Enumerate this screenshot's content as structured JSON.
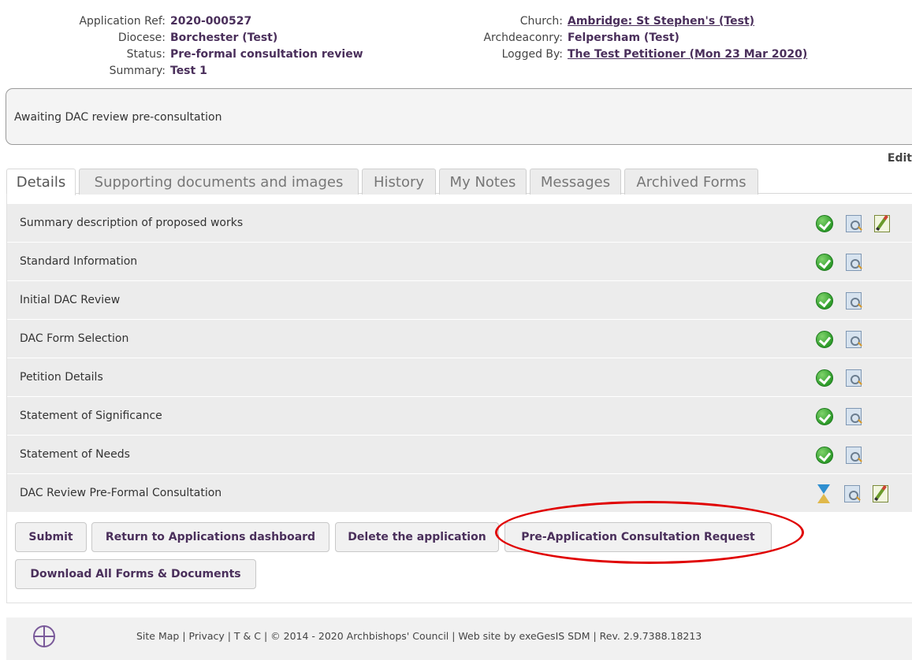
{
  "header": {
    "left": [
      {
        "label": "Application Ref:",
        "value": "2020-000527",
        "link": false
      },
      {
        "label": "Diocese:",
        "value": "Borchester (Test)",
        "link": false
      },
      {
        "label": "Status:",
        "value": "Pre-formal consultation review",
        "link": false
      },
      {
        "label": "Summary:",
        "value": "Test 1",
        "link": false
      }
    ],
    "right": [
      {
        "label": "Church:",
        "value": "Ambridge: St Stephen's (Test)",
        "link": true
      },
      {
        "label": "Archdeaconry:",
        "value": "Felpersham (Test)",
        "link": false
      },
      {
        "label": "Logged By:",
        "value": "The Test Petitioner (Mon 23 Mar 2020)",
        "link": true
      }
    ]
  },
  "status_message": "Awaiting DAC review pre-consultation",
  "edit_label": "Edit",
  "tabs": [
    {
      "label": "Details",
      "active": true
    },
    {
      "label": "Supporting documents and images",
      "active": false
    },
    {
      "label": "History",
      "active": false
    },
    {
      "label": "My Notes",
      "active": false
    },
    {
      "label": "Messages",
      "active": false
    },
    {
      "label": "Archived Forms",
      "active": false
    }
  ],
  "forms": [
    {
      "name": "Summary description of proposed works",
      "icons": [
        "check-icon",
        "view-icon",
        "edit-icon"
      ]
    },
    {
      "name": "Standard Information",
      "icons": [
        "check-icon",
        "view-icon"
      ]
    },
    {
      "name": "Initial DAC Review",
      "icons": [
        "check-icon",
        "view-icon"
      ]
    },
    {
      "name": "DAC Form Selection",
      "icons": [
        "check-icon",
        "view-icon"
      ]
    },
    {
      "name": "Petition Details",
      "icons": [
        "check-icon",
        "view-icon"
      ]
    },
    {
      "name": "Statement of Significance",
      "icons": [
        "check-icon",
        "view-icon"
      ]
    },
    {
      "name": "Statement of Needs",
      "icons": [
        "check-icon",
        "view-icon"
      ]
    },
    {
      "name": "DAC Review Pre-Formal Consultation",
      "icons": [
        "hourglass-icon",
        "view-icon",
        "edit-icon"
      ]
    }
  ],
  "buttons": {
    "submit": "Submit",
    "return": "Return to Applications dashboard",
    "delete": "Delete the application",
    "pre_app": "Pre-Application Consultation Request",
    "download": "Download All Forms & Documents"
  },
  "footer": {
    "text": "Site Map | Privacy | T & C | © 2014 - 2020 Archbishops' Council | Web site by exeGesIS SDM | Rev. 2.9.7388.18213"
  },
  "colors": {
    "link": "#4a2f5b",
    "highlight_circle": "#e00000",
    "row_bg": "#ececec"
  }
}
